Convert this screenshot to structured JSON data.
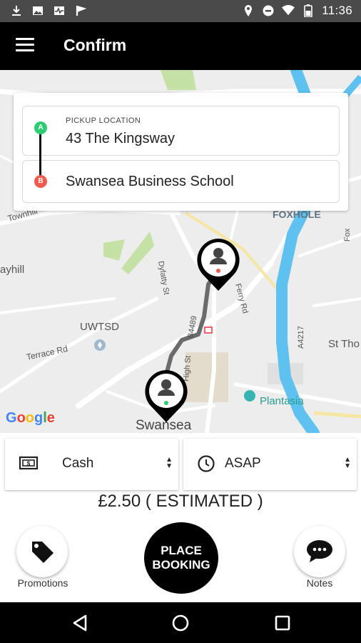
{
  "status_bar": {
    "time": "11:36",
    "left_icons": [
      "download-icon",
      "image-icon",
      "activity-icon",
      "flag-icon"
    ],
    "right_icons": [
      "location-pin-icon",
      "do-not-disturb-icon",
      "wifi-icon",
      "battery-icon"
    ]
  },
  "app_bar": {
    "title": "Confirm",
    "menu_icon": "hamburger-menu-icon"
  },
  "locations": {
    "pickup": {
      "marker": "A",
      "caption": "PICKUP LOCATION",
      "value": "43 The Kingsway",
      "color": "#2ecc71"
    },
    "destination": {
      "marker": "B",
      "value": "Swansea Business School",
      "color": "#ef5b4c"
    }
  },
  "map": {
    "labels": [
      "FOXHOLE",
      "Townhill",
      "ayhill",
      "UWTSD",
      "Terrace Rd",
      "St Tho",
      "Plantasia",
      "Swansea",
      "Dyfatty St",
      "B4489",
      "High St",
      "A4217",
      "Fox",
      "Ferry Rd"
    ],
    "attribution": "Google"
  },
  "payment": {
    "label": "Cash",
    "icon": "cash-icon"
  },
  "schedule": {
    "label": "ASAP",
    "icon": "clock-icon"
  },
  "price": {
    "text": "£2.50 ( ESTIMATED )"
  },
  "actions": {
    "promotions_label": "Promotions",
    "place_booking_line1": "PLACE",
    "place_booking_line2": "BOOKING",
    "notes_label": "Notes"
  },
  "nav_bar": {
    "icons": [
      "back-icon",
      "home-icon",
      "recents-icon"
    ]
  },
  "colors": {
    "accent": "#000000",
    "route": "#6b6b6b",
    "river": "#5ec1ef"
  }
}
